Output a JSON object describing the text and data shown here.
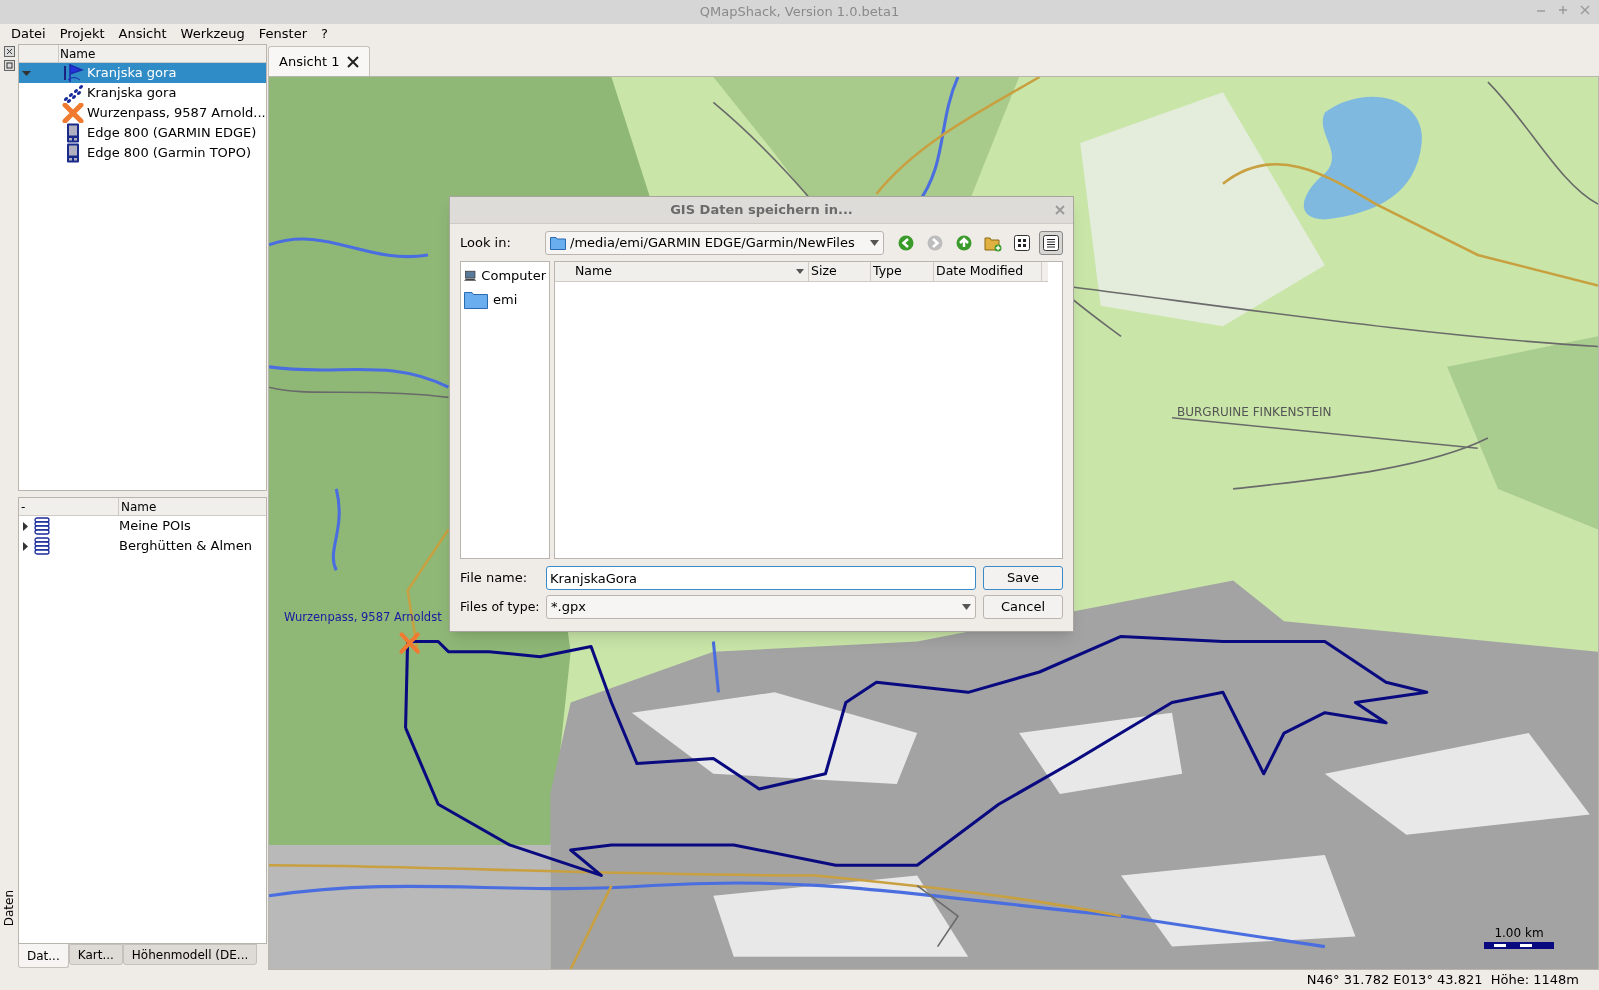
{
  "window": {
    "title": "QMapShack, Version 1.0.beta1"
  },
  "menu": [
    "Datei",
    "Projekt",
    "Ansicht",
    "Werkzeug",
    "Fenster",
    "?"
  ],
  "dock": {
    "title": "Daten"
  },
  "workspace": {
    "columns": [
      "Name"
    ],
    "items": [
      {
        "name": "Kranjska gora",
        "kind": "project",
        "selected": true,
        "expanded": true,
        "children": [
          {
            "name": "Kranjska gora",
            "kind": "track",
            "selected": false
          },
          {
            "name": "Wurzenpass, 9587 Arnold...",
            "kind": "waypoint",
            "selected": false
          },
          {
            "name": "Edge 800 (GARMIN EDGE)",
            "kind": "device",
            "selected": false
          },
          {
            "name": "Edge 800 (Garmin TOPO)",
            "kind": "device",
            "selected": false
          }
        ]
      }
    ]
  },
  "databases": {
    "columns": [
      "-",
      "Name"
    ],
    "items": [
      {
        "name": "Meine POIs",
        "expanded": false
      },
      {
        "name": "Berghütten & Almen",
        "expanded": false
      }
    ]
  },
  "dock_tabs": [
    {
      "label": "Dat...",
      "selected": true
    },
    {
      "label": "Kart...",
      "selected": false
    },
    {
      "label": "Höhenmodell (DE...",
      "selected": false
    }
  ],
  "view_tabs": [
    {
      "label": "Ansicht 1",
      "selected": true
    }
  ],
  "map": {
    "waypoint_label": "Wurzenpass, 9587 Arnoldst",
    "place_label": "BURGRUINE FINKENSTEIN",
    "scale": "1.00 km"
  },
  "dialog": {
    "title": "GIS Daten speichern in...",
    "look_in_label": "Look in:",
    "path": "/media/emi/GARMIN EDGE/Garmin/NewFiles",
    "toolbar": [
      {
        "kind": "back",
        "disabled": false
      },
      {
        "kind": "forward",
        "disabled": true
      },
      {
        "kind": "up",
        "disabled": false
      },
      {
        "kind": "new_folder"
      },
      {
        "kind": "list_view",
        "selected": false
      },
      {
        "kind": "detail_view",
        "selected": true
      }
    ],
    "places": [
      {
        "name": "Computer",
        "kind": "computer"
      },
      {
        "name": "emi",
        "kind": "folder"
      }
    ],
    "columns": [
      "Name",
      "Size",
      "Type",
      "Date Modified"
    ],
    "file_name_label": "File name:",
    "file_name": "KranjskaGora",
    "file_type_label": "Files of type:",
    "file_type": "*.gpx",
    "buttons": [
      {
        "label": "Save",
        "kind": "default"
      },
      {
        "label": "Cancel",
        "kind": "normal"
      }
    ]
  },
  "status_bar": "N46° 31.782 E013° 43.821  Höhe: 1148m"
}
